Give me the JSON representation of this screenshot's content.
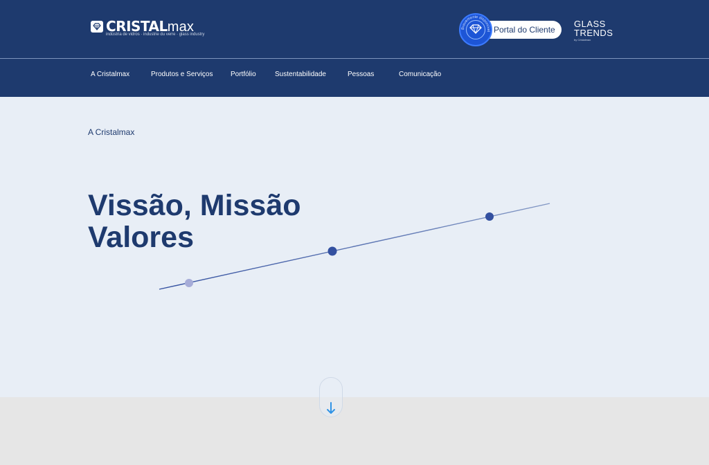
{
  "header": {
    "logo": {
      "name_bold": "CRISTAL",
      "name_light": "max",
      "tagline": "indústria de vidros · industrie du verre · glass industry"
    },
    "portal": {
      "label": "Portal do Cliente",
      "seal_text": "Brevemente disponível"
    },
    "glass_trends": {
      "line1": "GLASS",
      "line2": "TRENDS",
      "sub": "by Cristalmax"
    }
  },
  "nav": {
    "items": [
      {
        "label": "A Cristalmax"
      },
      {
        "label": "Produtos e Serviços"
      },
      {
        "label": "Portfólio"
      },
      {
        "label": "Sustentabilidade"
      },
      {
        "label": "Pessoas"
      },
      {
        "label": "Comunicação"
      }
    ]
  },
  "hero": {
    "breadcrumb": "A Cristalmax",
    "title_line1": "Vissão, Missão",
    "title_line2": "Valores"
  },
  "colors": {
    "brand_navy": "#1e3a6e",
    "hero_bg": "#e8eef6",
    "seal_blue": "#1d55d6",
    "dot_dark": "#3350a0",
    "dot_light": "#a6acd8",
    "arrow_blue": "#2f93e6"
  },
  "icons": {
    "logo": "diamond-icon",
    "seal": "diamond-icon",
    "scroll": "arrow-down-icon"
  }
}
